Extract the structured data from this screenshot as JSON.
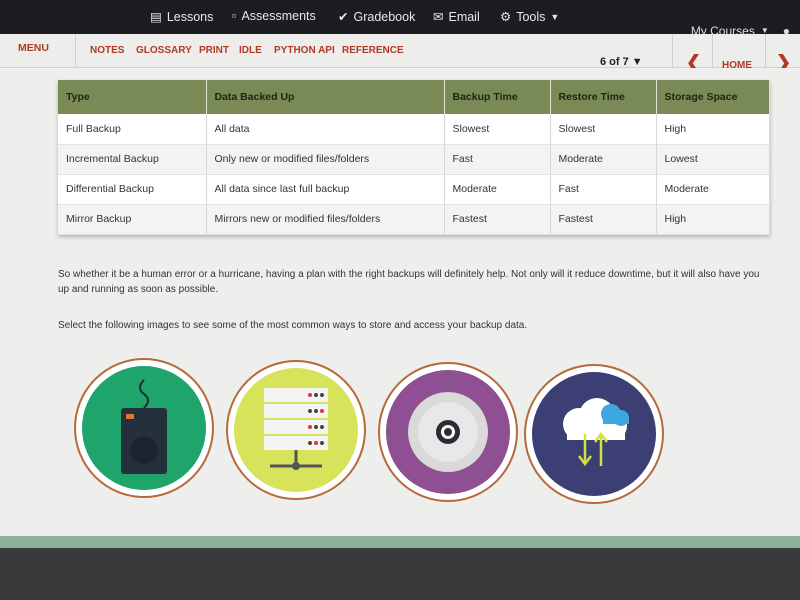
{
  "topnav": {
    "items": [
      {
        "label": "Lessons",
        "icon": "book-icon"
      },
      {
        "label": "Assessments",
        "icon": "folder-icon"
      },
      {
        "label": "Gradebook",
        "icon": "checkmark-icon"
      },
      {
        "label": "Email",
        "icon": "envelope-icon"
      },
      {
        "label": "Tools",
        "icon": "gear-icon"
      }
    ],
    "my_courses": "My Courses"
  },
  "menubar": {
    "menu_label": "MENU",
    "links": [
      "NOTES",
      "GLOSSARY",
      "PRINT",
      "IDLE",
      "PYTHON API",
      "REFERENCE"
    ],
    "page_indicator": "6 of 7 ▼",
    "home_label": "HOME"
  },
  "table": {
    "headers": [
      "Type",
      "Data Backed Up",
      "Backup Time",
      "Restore Time",
      "Storage Space"
    ],
    "rows": [
      [
        "Full Backup",
        "All data",
        "Slowest",
        "Slowest",
        "High"
      ],
      [
        "Incremental Backup",
        "Only new or modified files/folders",
        "Fast",
        "Moderate",
        "Lowest"
      ],
      [
        "Differential Backup",
        "All data since last full backup",
        "Moderate",
        "Fast",
        "Moderate"
      ],
      [
        "Mirror Backup",
        "Mirrors new or modified files/folders",
        "Fastest",
        "Fastest",
        "High"
      ]
    ]
  },
  "paragraphs": {
    "p1": "So whether it be a human error or a hurricane, having a plan with the right backups will definitely help. Not only will it reduce downtime, but it will also have you up and running as soon as possible.",
    "p2": "Select the following images to see some of the most common ways to store and access your backup data."
  },
  "images": [
    {
      "icon": "external-hard-drive-icon",
      "color": "#1fa46b"
    },
    {
      "icon": "server-rack-icon",
      "color": "#d6e35b"
    },
    {
      "icon": "optical-disc-icon",
      "color": "#8e4f93"
    },
    {
      "icon": "cloud-sync-icon",
      "color": "#3b3f73"
    }
  ],
  "colors": {
    "accent": "#b13a25",
    "table_header": "#7a8a56",
    "nav_bg": "#1b1d21"
  }
}
